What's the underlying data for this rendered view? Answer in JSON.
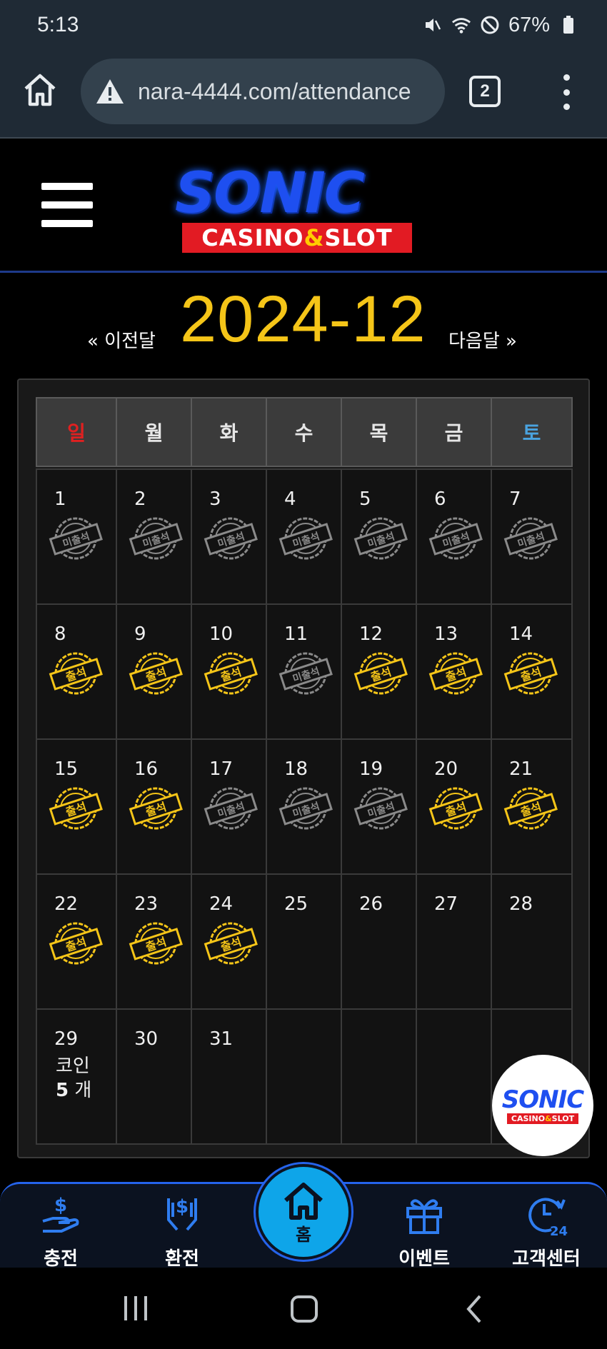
{
  "status_bar": {
    "time": "5:13",
    "battery": "67%"
  },
  "browser": {
    "url": "nara-4444.com/attendance",
    "tab_count": "2"
  },
  "logo": {
    "brand": "SONIC",
    "sub_left": "CASINO",
    "sub_amp": "&",
    "sub_right": "SLOT"
  },
  "calendar": {
    "prev_label": "« 이전달",
    "next_label": "다음달 »",
    "month_title": "2024-12",
    "weekdays": [
      "일",
      "월",
      "화",
      "수",
      "목",
      "금",
      "토"
    ],
    "stamp_labels": {
      "attended": "출석",
      "absent": "미출석"
    },
    "coin_label": "코인",
    "coin_count": "5",
    "coin_unit": "개",
    "days": [
      {
        "n": "1",
        "s": "absent"
      },
      {
        "n": "2",
        "s": "absent"
      },
      {
        "n": "3",
        "s": "absent"
      },
      {
        "n": "4",
        "s": "absent"
      },
      {
        "n": "5",
        "s": "absent"
      },
      {
        "n": "6",
        "s": "absent"
      },
      {
        "n": "7",
        "s": "absent"
      },
      {
        "n": "8",
        "s": "attended"
      },
      {
        "n": "9",
        "s": "attended"
      },
      {
        "n": "10",
        "s": "attended"
      },
      {
        "n": "11",
        "s": "absent"
      },
      {
        "n": "12",
        "s": "attended"
      },
      {
        "n": "13",
        "s": "attended"
      },
      {
        "n": "14",
        "s": "attended"
      },
      {
        "n": "15",
        "s": "attended"
      },
      {
        "n": "16",
        "s": "attended"
      },
      {
        "n": "17",
        "s": "absent"
      },
      {
        "n": "18",
        "s": "absent"
      },
      {
        "n": "19",
        "s": "absent"
      },
      {
        "n": "20",
        "s": "attended"
      },
      {
        "n": "21",
        "s": "attended"
      },
      {
        "n": "22",
        "s": "attended"
      },
      {
        "n": "23",
        "s": "attended"
      },
      {
        "n": "24",
        "s": "attended"
      },
      {
        "n": "25",
        "s": ""
      },
      {
        "n": "26",
        "s": ""
      },
      {
        "n": "27",
        "s": ""
      },
      {
        "n": "28",
        "s": ""
      },
      {
        "n": "29",
        "s": "coin"
      },
      {
        "n": "30",
        "s": ""
      },
      {
        "n": "31",
        "s": ""
      },
      {
        "n": "",
        "s": ""
      },
      {
        "n": "",
        "s": ""
      },
      {
        "n": "",
        "s": ""
      },
      {
        "n": "",
        "s": ""
      }
    ]
  },
  "bottom_nav": {
    "charge": "충전",
    "exchange": "환전",
    "home": "홈",
    "event": "이벤트",
    "support": "고객센터"
  },
  "colors": {
    "accent_gold": "#f5c518",
    "stamp_gray": "#8a8a8a",
    "nav_blue": "#2563eb",
    "home_cyan": "#0ea5e9",
    "sunday_red": "#e02020",
    "saturday_blue": "#4aa3df"
  }
}
